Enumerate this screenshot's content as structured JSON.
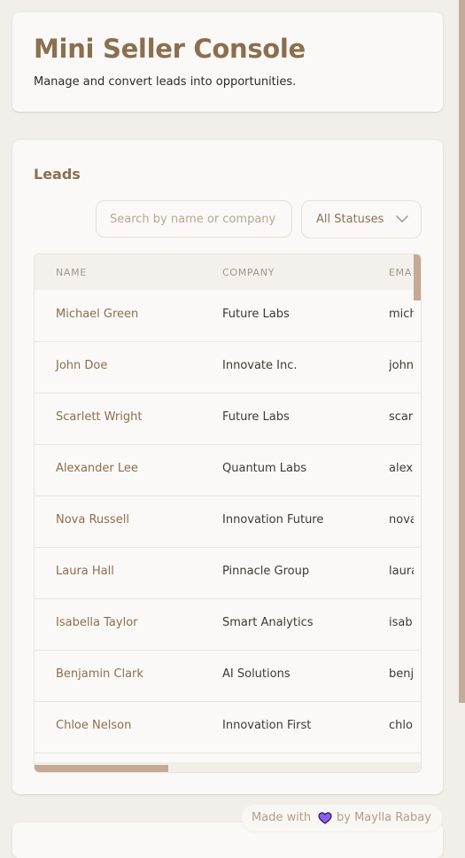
{
  "header": {
    "title": "Mini Seller Console",
    "subtitle": "Manage and convert leads into opportunities."
  },
  "leads": {
    "title": "Leads",
    "search_placeholder": "Search by name or company",
    "status_filter": "All Statuses",
    "columns": [
      "NAME",
      "COMPANY",
      "EMA"
    ],
    "rows": [
      {
        "name": "Michael Green",
        "company": "Future Labs",
        "email": "mich"
      },
      {
        "name": "John Doe",
        "company": "Innovate Inc.",
        "email": "john"
      },
      {
        "name": "Scarlett Wright",
        "company": "Future Labs",
        "email": "scar"
      },
      {
        "name": "Alexander Lee",
        "company": "Quantum Labs",
        "email": "alex"
      },
      {
        "name": "Nova Russell",
        "company": "Innovation Future",
        "email": "nova"
      },
      {
        "name": "Laura Hall",
        "company": "Pinnacle Group",
        "email": "laura"
      },
      {
        "name": "Isabella Taylor",
        "company": "Smart Analytics",
        "email": "isab"
      },
      {
        "name": "Benjamin Clark",
        "company": "AI Solutions",
        "email": "benj"
      },
      {
        "name": "Chloe Nelson",
        "company": "Innovation First",
        "email": "chlo"
      }
    ]
  },
  "footer": {
    "made_with": "Made with",
    "by": "by Maylla Rabay",
    "heart_icon": "heart-icon",
    "heart_color": "#8a5cf0"
  },
  "colors": {
    "accent": "#8b6f4e",
    "background": "#f2efea",
    "card": "#faf9f7",
    "scrollbar": "#c4a995"
  }
}
